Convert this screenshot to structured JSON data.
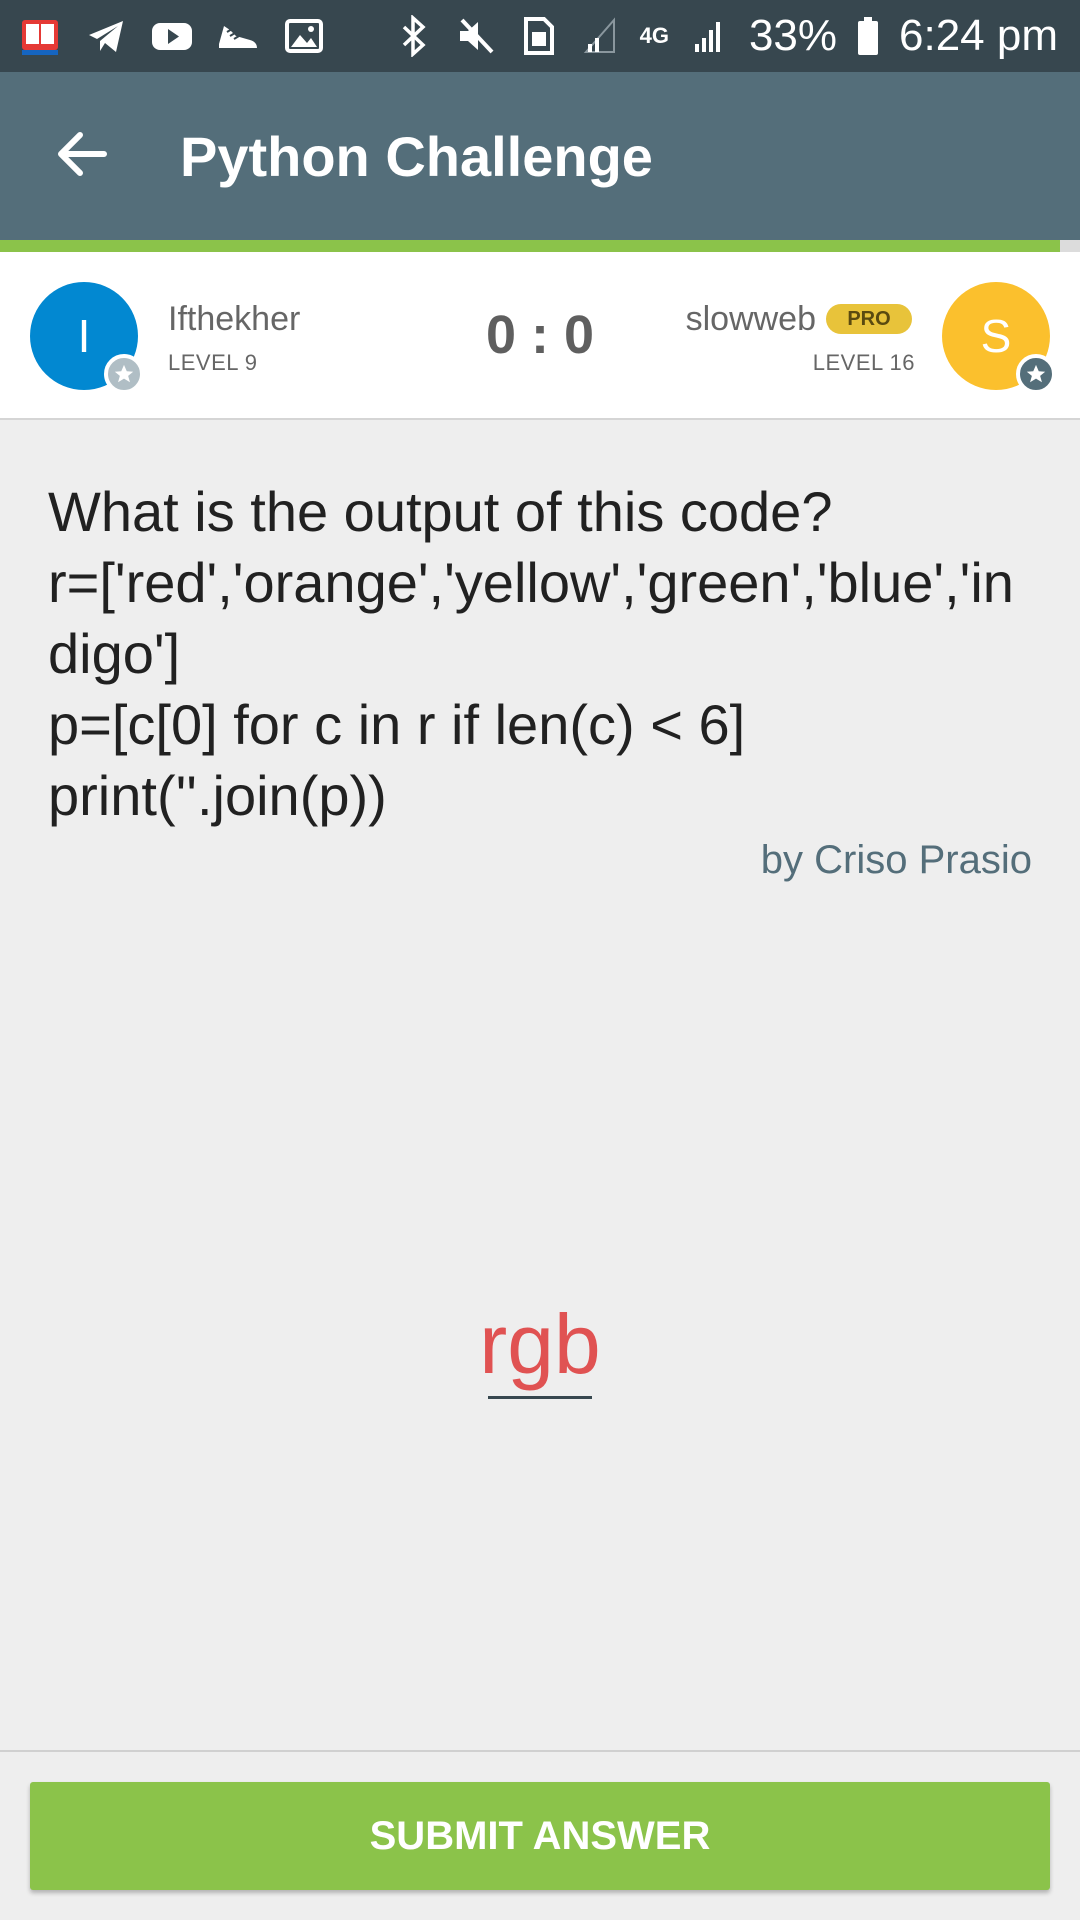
{
  "status_bar": {
    "battery": "33%",
    "time": "6:24 pm",
    "network": "4G",
    "icons_left": [
      "dictionary-app-icon",
      "telegram-icon",
      "youtube-icon",
      "shoe-icon",
      "image-icon"
    ],
    "icons_right": [
      "bluetooth-icon",
      "mute-icon",
      "sim-icon",
      "signal-icon",
      "battery-icon"
    ]
  },
  "app_bar": {
    "title": "Python Challenge",
    "back_icon": "arrow-left-icon"
  },
  "players": {
    "left": {
      "initial": "I",
      "name": "Ifthekher",
      "level": "LEVEL 9",
      "color": "#0288d1"
    },
    "right": {
      "initial": "S",
      "name": "slowweb",
      "badge": "PRO",
      "level": "LEVEL 16",
      "color": "#fbc02d"
    },
    "score": "0 : 0"
  },
  "question": {
    "text": "What is the output of this code?\nr=['red','orange','yellow','green','blue','indigo']\np=[c[0] for c in r if len(c) < 6]\nprint(''.join(p))",
    "author": "by Criso Prasio"
  },
  "answer": {
    "value": "rgb",
    "color": "#e05252"
  },
  "footer": {
    "submit_label": "SUBMIT ANSWER",
    "accent": "#8bc34a"
  }
}
